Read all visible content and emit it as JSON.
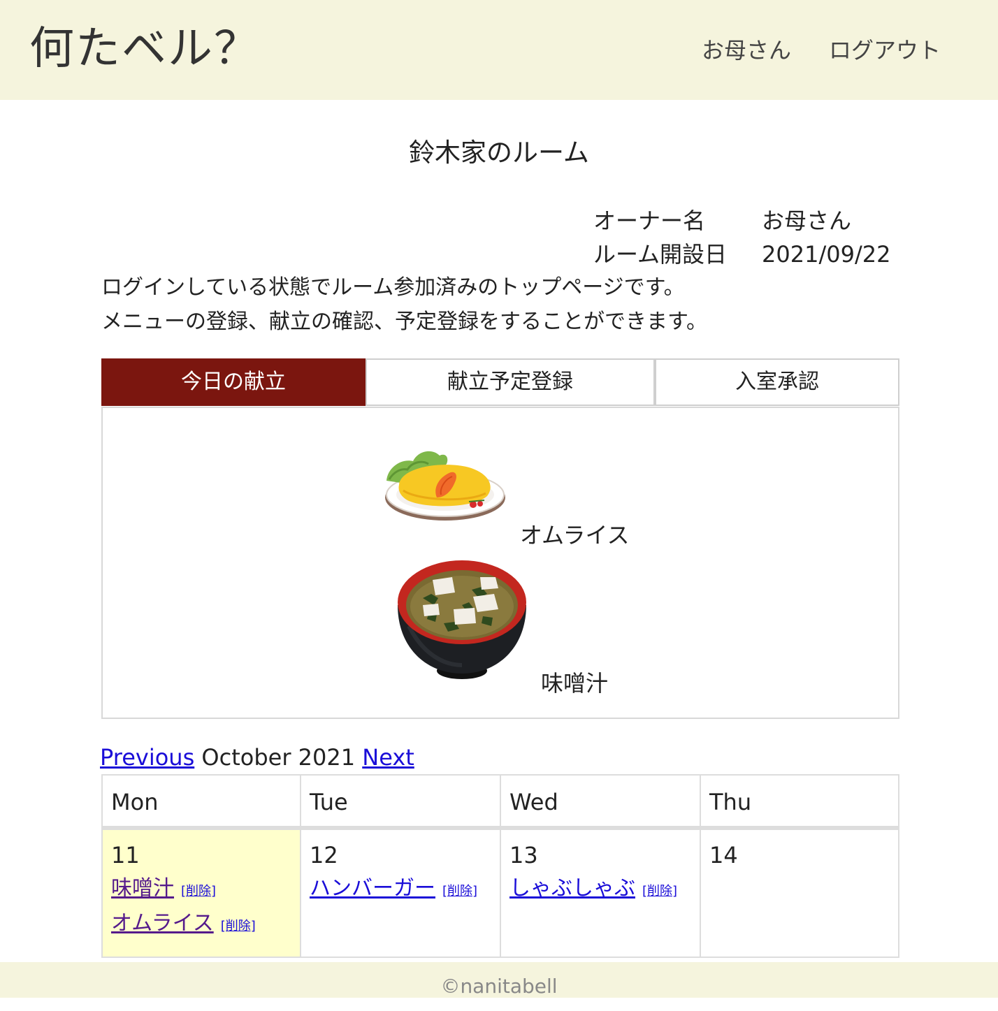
{
  "header": {
    "app_title": "何たベル？",
    "user_name": "お母さん",
    "logout_label": "ログアウト"
  },
  "room": {
    "title": "鈴木家のルーム",
    "owner_label": "オーナー名",
    "owner_value": "お母さん",
    "created_label": "ルーム開設日",
    "created_value": "2021/09/22",
    "description": [
      "ログインしている状態でルーム参加済みのトップページです。",
      "メニューの登録、献立の確認、予定登録をすることができます。"
    ]
  },
  "tabs": [
    {
      "label": "今日の献立",
      "active": true
    },
    {
      "label": "献立予定登録",
      "active": false
    },
    {
      "label": "入室承認",
      "active": false
    }
  ],
  "today_menu": [
    {
      "name": "オムライス",
      "icon": "omurice-icon"
    },
    {
      "name": "味噌汁",
      "icon": "miso-soup-icon"
    }
  ],
  "calendar": {
    "prev_label": "Previous",
    "month_label": "October 2021",
    "next_label": "Next",
    "headers": [
      "Mon",
      "Tue",
      "Wed",
      "Thu"
    ],
    "delete_label": "[削除]",
    "days": [
      {
        "day": "11",
        "today": true,
        "entries": [
          {
            "name": "味噌汁",
            "visited": true
          },
          {
            "name": "オムライス",
            "visited": true
          }
        ]
      },
      {
        "day": "12",
        "today": false,
        "entries": [
          {
            "name": "ハンバーガー",
            "visited": false
          }
        ]
      },
      {
        "day": "13",
        "today": false,
        "entries": [
          {
            "name": "しゃぶしゃぶ",
            "visited": false
          }
        ]
      },
      {
        "day": "14",
        "today": false,
        "entries": []
      }
    ]
  },
  "footer": {
    "copyright": "©nanitabell"
  },
  "colors": {
    "header_bg": "#f5f4dd",
    "active_tab": "#7b160f",
    "today_cell": "#ffffcc",
    "link": "#1a0dd8",
    "visited_link": "#551a8b"
  }
}
